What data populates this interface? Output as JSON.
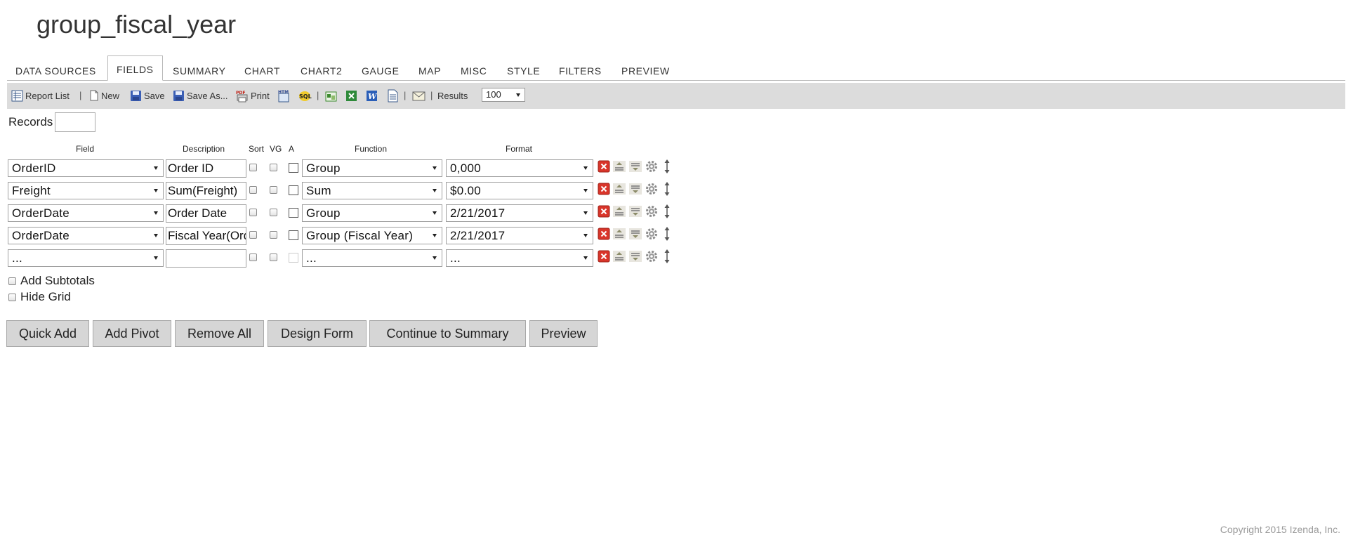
{
  "report_title": "group_fiscal_year",
  "tabs": [
    "DATA SOURCES",
    "FIELDS",
    "SUMMARY",
    "CHART",
    "CHART2",
    "GAUGE",
    "MAP",
    "MISC",
    "STYLE",
    "FILTERS",
    "PREVIEW"
  ],
  "active_tab": "FIELDS",
  "toolbar": {
    "report_list": "Report List",
    "new": "New",
    "save": "Save",
    "save_as": "Save As...",
    "print": "Print",
    "separator": "|",
    "results_label": "Results",
    "results_value": "100"
  },
  "records": {
    "label": "Records",
    "value": ""
  },
  "columns": {
    "field": "Field",
    "description": "Description",
    "sort": "Sort",
    "vg": "VG",
    "a": "A",
    "function": "Function",
    "format": "Format"
  },
  "rows": [
    {
      "field": "OrderID",
      "description": "Order ID",
      "function": "Group",
      "format": "0,000"
    },
    {
      "field": "Freight",
      "description": "Sum(Freight)",
      "function": "Sum",
      "format": "$0.00"
    },
    {
      "field": "OrderDate",
      "description": "Order Date",
      "function": "Group",
      "format": "2/21/2017"
    },
    {
      "field": "OrderDate",
      "description": "Fiscal Year(OrderDate)",
      "function": "Group (Fiscal Year)",
      "format": "2/21/2017"
    },
    {
      "field": "...",
      "description": "",
      "function": "...",
      "format": "..."
    }
  ],
  "options": {
    "add_subtotals": "Add Subtotals",
    "hide_grid": "Hide Grid"
  },
  "buttons": {
    "quick_add": "Quick Add",
    "add_pivot": "Add Pivot",
    "remove_all": "Remove All",
    "design_form": "Design Form",
    "continue_to_summary": "Continue to Summary",
    "preview": "Preview"
  },
  "footer": {
    "copyright": "Copyright 2015 Izenda, Inc."
  },
  "colors": {
    "delete": "#d9352a",
    "toolbar_bg": "#dcdcdc",
    "button_bg": "#d6d6d6"
  }
}
